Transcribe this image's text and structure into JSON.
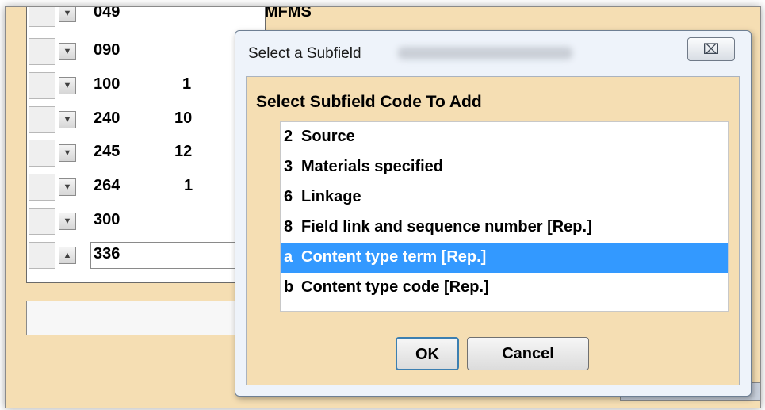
{
  "editor": {
    "rows": [
      {
        "tag": "049",
        "ind": "",
        "value": "MFMS",
        "expander": "▼"
      },
      {
        "tag": "090",
        "ind": "",
        "value": "",
        "expander": "▼"
      },
      {
        "tag": "100",
        "ind": "1",
        "value": "",
        "expander": "▼"
      },
      {
        "tag": "240",
        "ind": "10",
        "value": "",
        "expander": "▼"
      },
      {
        "tag": "245",
        "ind": "12",
        "value": "",
        "expander": "▼"
      },
      {
        "tag": "264",
        "ind": "1",
        "value": "",
        "expander": "▼"
      },
      {
        "tag": "300",
        "ind": "",
        "value": "",
        "expander": "▼"
      },
      {
        "tag": "336",
        "ind": "",
        "value": "",
        "expander": "▲"
      }
    ]
  },
  "dialog": {
    "title": "Select a Subfield",
    "close_glyph": "⌧",
    "heading": "Select Subfield Code To Add",
    "options": [
      {
        "code": "2",
        "label": "Source",
        "selected": false
      },
      {
        "code": "3",
        "label": "Materials specified",
        "selected": false
      },
      {
        "code": "6",
        "label": "Linkage",
        "selected": false
      },
      {
        "code": "8",
        "label": "Field link and sequence number [Rep.]",
        "selected": false
      },
      {
        "code": "a",
        "label": "Content type term [Rep.]",
        "selected": true
      },
      {
        "code": "b",
        "label": "Content type code [Rep.]",
        "selected": false
      }
    ],
    "ok_label": "OK",
    "cancel_label": "Cancel"
  },
  "colors": {
    "window_bg": "#f5deb3",
    "selection": "#3399ff"
  }
}
